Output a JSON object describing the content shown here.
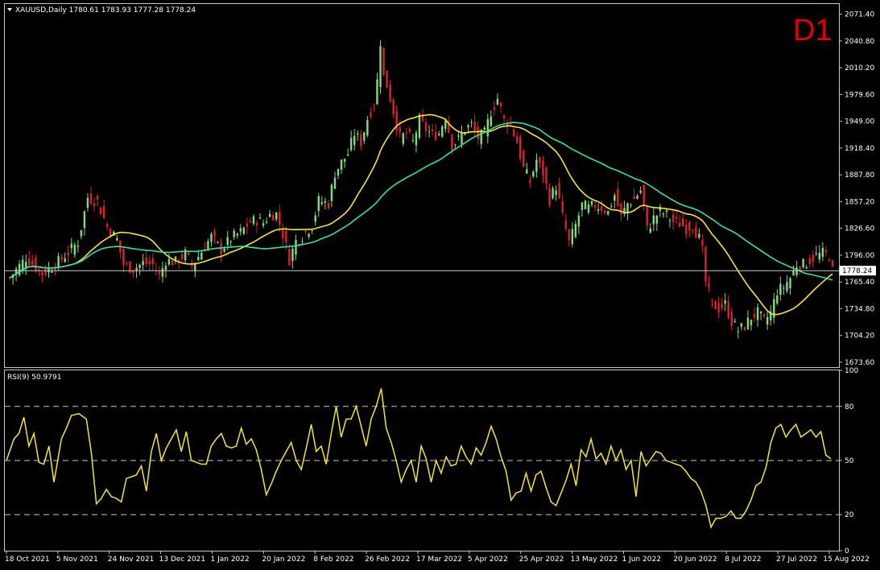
{
  "header": {
    "symbol_line": "XAUUSD,Daily  1780.61 1783.93 1777.28 1778.24",
    "timeframe": "D1"
  },
  "rsi_header": "RSI(9) 50.9791",
  "colors": {
    "background": "#000000",
    "frame": "#c8c8c8",
    "bull_candle": "#7fdc7f",
    "bear_candle": "#e0202a",
    "fast_ma": "#f5e631",
    "slow_ma": "#2fe3a6",
    "rsi": "#f5e631",
    "timeframe_label": "#e00000"
  },
  "chart_data": [
    {
      "type": "candlestick",
      "symbol": "XAUUSD",
      "period": "Daily",
      "yticks": [
        "2071.40",
        "2040.80",
        "2010.20",
        "1979.60",
        "1949.00",
        "1918.40",
        "1887.80",
        "1857.20",
        "1826.60",
        "1796.00",
        "1765.40",
        "1734.80",
        "1704.20",
        "1673.60"
      ],
      "ylim": [
        1668,
        2083
      ],
      "current_price": "1778.24",
      "xticks": [
        "18 Oct 2021",
        "5 Nov 2021",
        "24 Nov 2021",
        "13 Dec 2021",
        "1 Jan 2022",
        "20 Jan 2022",
        "8 Feb 2022",
        "26 Feb 2022",
        "17 Mar 2022",
        "5 Apr 2022",
        "25 Apr 2022",
        "13 May 2022",
        "1 Jun 2022",
        "20 Jun 2022",
        "8 Jul 2022",
        "27 Jul 2022",
        "15 Aug 2022"
      ],
      "close_anchors": [
        [
          0,
          1770
        ],
        [
          5,
          1793
        ],
        [
          10,
          1775
        ],
        [
          14,
          1785
        ],
        [
          18,
          1799
        ],
        [
          21,
          1811
        ],
        [
          24,
          1862
        ],
        [
          27,
          1857
        ],
        [
          30,
          1828
        ],
        [
          33,
          1814
        ],
        [
          35,
          1785
        ],
        [
          38,
          1780
        ],
        [
          41,
          1787
        ],
        [
          44,
          1785
        ],
        [
          46,
          1772
        ],
        [
          48,
          1790
        ],
        [
          51,
          1788
        ],
        [
          54,
          1798
        ],
        [
          56,
          1784
        ],
        [
          59,
          1800
        ],
        [
          62,
          1817
        ],
        [
          65,
          1802
        ],
        [
          68,
          1815
        ],
        [
          71,
          1822
        ],
        [
          74,
          1834
        ],
        [
          76,
          1836
        ],
        [
          78,
          1833
        ],
        [
          80,
          1842
        ],
        [
          82,
          1843
        ],
        [
          84,
          1820
        ],
        [
          86,
          1791
        ],
        [
          88,
          1812
        ],
        [
          90,
          1818
        ],
        [
          93,
          1830
        ],
        [
          95,
          1858
        ],
        [
          98,
          1855
        ],
        [
          100,
          1890
        ],
        [
          102,
          1902
        ],
        [
          104,
          1912
        ],
        [
          106,
          1935
        ],
        [
          108,
          1925
        ],
        [
          110,
          1952
        ],
        [
          112,
          1970
        ],
        [
          113,
          1995
        ],
        [
          114,
          2040
        ],
        [
          115,
          2000
        ],
        [
          116,
          1990
        ],
        [
          118,
          1960
        ],
        [
          120,
          1930
        ],
        [
          122,
          1935
        ],
        [
          124,
          1925
        ],
        [
          126,
          1950
        ],
        [
          128,
          1940
        ],
        [
          130,
          1933
        ],
        [
          132,
          1935
        ],
        [
          134,
          1955
        ],
        [
          136,
          1922
        ],
        [
          138,
          1928
        ],
        [
          140,
          1940
        ],
        [
          142,
          1945
        ],
        [
          144,
          1930
        ],
        [
          146,
          1935
        ],
        [
          148,
          1960
        ],
        [
          150,
          1975
        ],
        [
          152,
          1950
        ],
        [
          154,
          1945
        ],
        [
          156,
          1925
        ],
        [
          158,
          1895
        ],
        [
          160,
          1880
        ],
        [
          162,
          1905
        ],
        [
          164,
          1890
        ],
        [
          166,
          1860
        ],
        [
          168,
          1875
        ],
        [
          170,
          1840
        ],
        [
          172,
          1810
        ],
        [
          174,
          1830
        ],
        [
          176,
          1853
        ],
        [
          178,
          1850
        ],
        [
          180,
          1853
        ],
        [
          182,
          1850
        ],
        [
          184,
          1845
        ],
        [
          186,
          1865
        ],
        [
          188,
          1840
        ],
        [
          190,
          1855
        ],
        [
          192,
          1860
        ],
        [
          194,
          1870
        ],
        [
          195,
          1850
        ],
        [
          196,
          1825
        ],
        [
          198,
          1838
        ],
        [
          200,
          1846
        ],
        [
          202,
          1842
        ],
        [
          204,
          1834
        ],
        [
          206,
          1832
        ],
        [
          208,
          1827
        ],
        [
          210,
          1830
        ],
        [
          212,
          1815
        ],
        [
          213,
          1800
        ],
        [
          214,
          1765
        ],
        [
          216,
          1740
        ],
        [
          218,
          1735
        ],
        [
          220,
          1740
        ],
        [
          222,
          1720
        ],
        [
          224,
          1710
        ],
        [
          226,
          1715
        ],
        [
          228,
          1725
        ],
        [
          230,
          1730
        ],
        [
          232,
          1720
        ],
        [
          234,
          1730
        ],
        [
          236,
          1755
        ],
        [
          238,
          1760
        ],
        [
          240,
          1770
        ],
        [
          242,
          1785
        ],
        [
          244,
          1785
        ],
        [
          246,
          1790
        ],
        [
          248,
          1795
        ],
        [
          250,
          1798
        ],
        [
          252,
          1795
        ],
        [
          253,
          1778
        ]
      ],
      "series": [
        {
          "name": "fast MA",
          "color": "#f5e631"
        },
        {
          "name": "slow MA",
          "color": "#2fe3a6"
        }
      ]
    },
    {
      "type": "line",
      "name": "RSI(9)",
      "value": 50.9791,
      "ylim": [
        0,
        100
      ],
      "levels": [
        20,
        50,
        80
      ],
      "yticks": [
        "100",
        "80",
        "50",
        "20",
        "0"
      ],
      "anchors": [
        [
          0,
          50
        ],
        [
          3,
          62
        ],
        [
          5,
          65
        ],
        [
          7,
          74
        ],
        [
          9,
          58
        ],
        [
          11,
          65
        ],
        [
          13,
          49
        ],
        [
          15,
          48
        ],
        [
          17,
          58
        ],
        [
          19,
          38
        ],
        [
          22,
          62
        ],
        [
          24,
          68
        ],
        [
          26,
          75
        ],
        [
          29,
          76
        ],
        [
          32,
          73
        ],
        [
          34,
          54
        ],
        [
          36,
          26
        ],
        [
          38,
          29
        ],
        [
          40,
          34
        ],
        [
          42,
          30
        ],
        [
          44,
          29
        ],
        [
          46,
          27
        ],
        [
          48,
          40
        ],
        [
          50,
          41
        ],
        [
          52,
          42
        ],
        [
          54,
          47
        ],
        [
          56,
          33
        ],
        [
          58,
          55
        ],
        [
          60,
          65
        ],
        [
          62,
          50
        ],
        [
          64,
          57
        ],
        [
          66,
          62
        ],
        [
          68,
          67
        ],
        [
          70,
          55
        ],
        [
          72,
          66
        ],
        [
          74,
          50
        ],
        [
          76,
          49
        ],
        [
          78,
          48
        ],
        [
          80,
          48
        ],
        [
          82,
          58
        ],
        [
          84,
          62
        ],
        [
          86,
          65
        ],
        [
          88,
          58
        ],
        [
          90,
          57
        ],
        [
          92,
          58
        ],
        [
          94,
          68
        ],
        [
          96,
          59
        ],
        [
          98,
          62
        ],
        [
          100,
          56
        ],
        [
          102,
          45
        ],
        [
          104,
          31
        ],
        [
          106,
          37
        ],
        [
          108,
          44
        ],
        [
          110,
          50
        ],
        [
          112,
          55
        ],
        [
          114,
          60
        ],
        [
          116,
          50
        ],
        [
          118,
          45
        ],
        [
          120,
          57
        ],
        [
          122,
          70
        ],
        [
          124,
          55
        ],
        [
          126,
          58
        ],
        [
          128,
          48
        ],
        [
          130,
          65
        ],
        [
          132,
          80
        ],
        [
          134,
          63
        ],
        [
          136,
          73
        ],
        [
          138,
          73
        ],
        [
          140,
          80
        ],
        [
          142,
          69
        ],
        [
          144,
          58
        ],
        [
          146,
          73
        ],
        [
          148,
          80
        ],
        [
          150,
          90
        ],
        [
          152,
          68
        ],
        [
          154,
          60
        ],
        [
          156,
          50
        ],
        [
          158,
          38
        ],
        [
          160,
          45
        ],
        [
          162,
          50
        ],
        [
          164,
          38
        ],
        [
          166,
          58
        ],
        [
          168,
          51
        ],
        [
          170,
          38
        ],
        [
          172,
          50
        ],
        [
          174,
          43
        ],
        [
          176,
          52
        ],
        [
          178,
          47
        ],
        [
          180,
          48
        ],
        [
          182,
          58
        ],
        [
          184,
          52
        ],
        [
          186,
          48
        ],
        [
          188,
          57
        ],
        [
          190,
          53
        ],
        [
          192,
          60
        ],
        [
          194,
          69
        ],
        [
          196,
          62
        ],
        [
          198,
          52
        ],
        [
          200,
          44
        ],
        [
          202,
          28
        ],
        [
          204,
          32
        ],
        [
          206,
          33
        ],
        [
          208,
          43
        ],
        [
          210,
          33
        ],
        [
          212,
          42
        ],
        [
          214,
          44
        ],
        [
          216,
          35
        ],
        [
          218,
          27
        ],
        [
          220,
          25
        ],
        [
          222,
          32
        ],
        [
          224,
          39
        ],
        [
          226,
          48
        ],
        [
          228,
          36
        ],
        [
          230,
          56
        ],
        [
          232,
          52
        ],
        [
          234,
          62
        ],
        [
          236,
          51
        ],
        [
          238,
          54
        ],
        [
          240,
          48
        ],
        [
          242,
          58
        ],
        [
          244,
          50
        ],
        [
          246,
          56
        ],
        [
          248,
          45
        ],
        [
          250,
          50
        ],
        [
          252,
          30
        ],
        [
          254,
          55
        ],
        [
          256,
          47
        ],
        [
          258,
          51
        ],
        [
          260,
          55
        ],
        [
          262,
          54
        ],
        [
          264,
          50
        ],
        [
          266,
          49
        ],
        [
          268,
          48
        ],
        [
          270,
          47
        ],
        [
          272,
          44
        ],
        [
          274,
          40
        ],
        [
          276,
          38
        ],
        [
          278,
          33
        ],
        [
          280,
          25
        ],
        [
          282,
          13
        ],
        [
          284,
          18
        ],
        [
          286,
          18
        ],
        [
          288,
          19
        ],
        [
          290,
          22
        ],
        [
          292,
          18
        ],
        [
          294,
          18
        ],
        [
          296,
          22
        ],
        [
          298,
          28
        ],
        [
          300,
          36
        ],
        [
          302,
          38
        ],
        [
          304,
          46
        ],
        [
          306,
          60
        ],
        [
          308,
          68
        ],
        [
          310,
          70
        ],
        [
          312,
          63
        ],
        [
          314,
          67
        ],
        [
          316,
          70
        ],
        [
          318,
          63
        ],
        [
          320,
          65
        ],
        [
          322,
          67
        ],
        [
          324,
          63
        ],
        [
          326,
          66
        ],
        [
          328,
          53
        ],
        [
          330,
          51
        ]
      ]
    }
  ]
}
